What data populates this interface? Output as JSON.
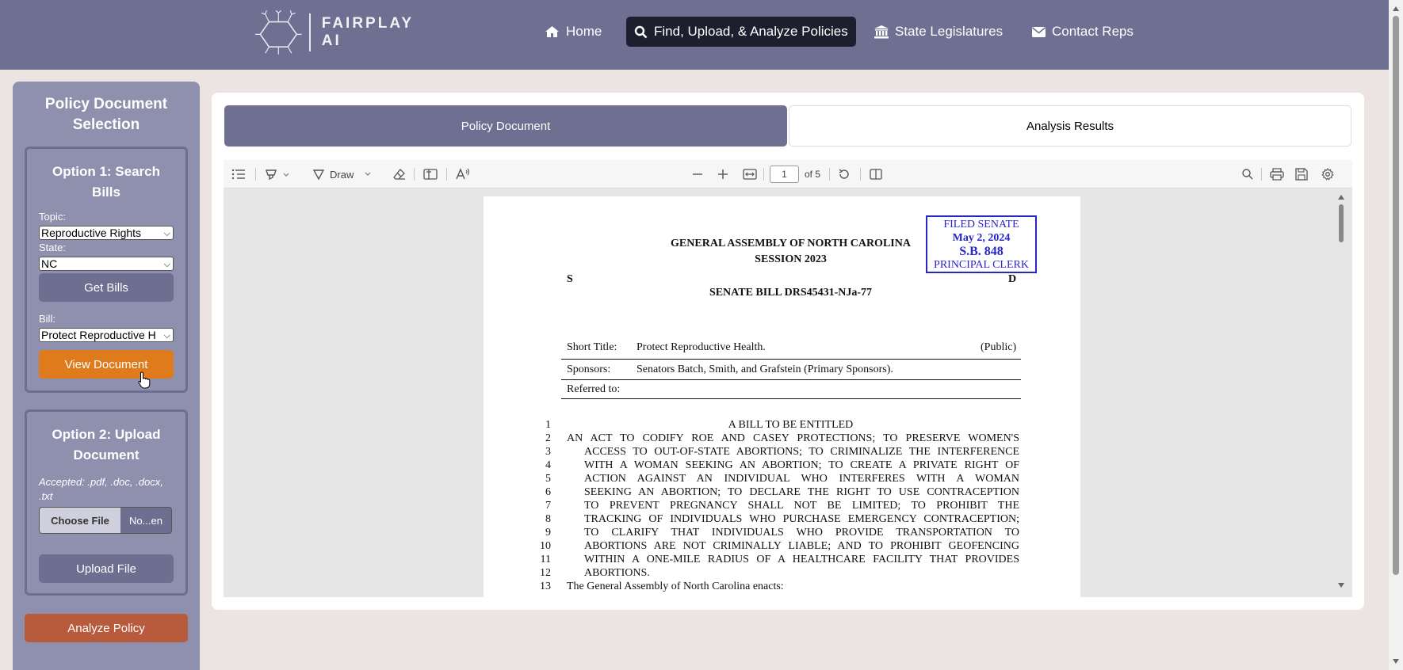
{
  "brand": {
    "line1": "FAIRPLAY",
    "line2": "AI"
  },
  "nav": [
    {
      "label": "Home",
      "icon": "home-icon"
    },
    {
      "label": "Find, Upload, & Analyze Policies",
      "icon": "search-icon"
    },
    {
      "label": "State Legislatures",
      "icon": "landmark-icon"
    },
    {
      "label": "Contact Reps",
      "icon": "envelope-icon"
    }
  ],
  "sidebar": {
    "title": "Policy Document Selection",
    "option1": {
      "title": "Option 1: Search Bills",
      "topic_label": "Topic:",
      "topic_value": "Reproductive Rights",
      "state_label": "State:",
      "state_value": "NC",
      "get_bills": "Get Bills",
      "bill_label": "Bill:",
      "bill_value": "Protect Reproductive H",
      "view_document": "View Document"
    },
    "option2": {
      "title": "Option 2: Upload Document",
      "accepted": "Accepted: .pdf, .doc, .docx, .txt",
      "choose_file": "Choose File",
      "no_file": "No...en",
      "upload": "Upload File"
    },
    "analyze": "Analyze Policy"
  },
  "tabs": {
    "document": "Policy Document",
    "analysis": "Analysis Results"
  },
  "viewer": {
    "draw_label": "Draw",
    "page_number": "1",
    "page_total": "of 5"
  },
  "doc": {
    "stamp": [
      "FILED SENATE",
      "May 2, 2024",
      "S.B. 848",
      "PRINCIPAL CLERK"
    ],
    "assembly": "GENERAL ASSEMBLY OF NORTH CAROLINA",
    "session": "SESSION 2023",
    "left_letter": "S",
    "right_letter": "D",
    "bill_id": "SENATE BILL DRS45431-NJa-77",
    "short_title_label": "Short Title:",
    "short_title": "Protect Reproductive Health.",
    "public": "(Public)",
    "sponsors_label": "Sponsors:",
    "sponsors": "Senators Batch, Smith, and Grafstein (Primary Sponsors).",
    "referred_label": "Referred to:",
    "lines": [
      {
        "n": "1",
        "t": "A BILL TO BE ENTITLED"
      },
      {
        "n": "2",
        "t": "AN ACT TO CODIFY ROE AND CASEY PROTECTIONS; TO PRESERVE WOMEN'S"
      },
      {
        "n": "3",
        "t": "ACCESS TO OUT-OF-STATE ABORTIONS; TO CRIMINALIZE THE INTERFERENCE"
      },
      {
        "n": "4",
        "t": "WITH A WOMAN SEEKING AN ABORTION; TO CREATE A PRIVATE RIGHT OF"
      },
      {
        "n": "5",
        "t": "ACTION AGAINST AN INDIVIDUAL WHO INTERFERES WITH A WOMAN"
      },
      {
        "n": "6",
        "t": "SEEKING AN ABORTION; TO DECLARE THE RIGHT TO USE CONTRACEPTION"
      },
      {
        "n": "7",
        "t": "TO PREVENT PREGNANCY SHALL NOT BE LIMITED; TO PROHIBIT THE"
      },
      {
        "n": "8",
        "t": "TRACKING OF INDIVIDUALS WHO PURCHASE EMERGENCY CONTRACEPTION;"
      },
      {
        "n": "9",
        "t": "TO CLARIFY THAT INDIVIDUALS WHO PROVIDE TRANSPORTATION TO"
      },
      {
        "n": "10",
        "t": "ABORTIONS ARE NOT CRIMINALLY LIABLE; AND TO PROHIBIT GEOFENCING"
      },
      {
        "n": "11",
        "t": "WITHIN A ONE-MILE RADIUS OF A HEALTHCARE FACILITY THAT PROVIDES"
      },
      {
        "n": "12",
        "t": "ABORTIONS."
      },
      {
        "n": "13",
        "t": "The General Assembly of North Carolina enacts:"
      }
    ]
  }
}
